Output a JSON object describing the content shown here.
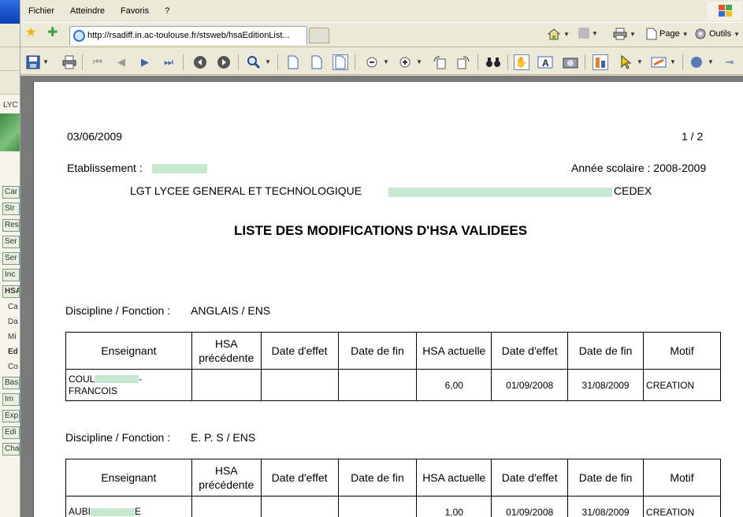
{
  "menu": [
    "Fichier",
    "Atteindre",
    "Favoris",
    "?"
  ],
  "address": {
    "url": "http://rsadiff.in.ac-toulouse.fr/stsweb/hsaEditionList..."
  },
  "ie_tools": {
    "page_label": "Page",
    "tools_label": "Outils"
  },
  "background_window": {
    "header": "LYC",
    "nav_items": [
      "Car",
      "Str",
      "Res",
      "Ser",
      "Ser",
      "Inc",
      "HSA"
    ],
    "sub_items": [
      "Ca",
      "Da",
      "Mi",
      "Ed",
      "Co"
    ],
    "nav_items_2": [
      "Bas",
      "Im",
      "Exp",
      "Edi",
      "Cha"
    ]
  },
  "document": {
    "date": "03/06/2009",
    "pagination": "1 / 2",
    "etab_label": "Etablissement :",
    "school_year": "Année scolaire : 2008-2009",
    "school_name_start": "LGT LYCEE GENERAL ET TECHNOLOGIQUE",
    "school_name_end": "CEDEX",
    "title": "LISTE DES MODIFICATIONS D'HSA VALIDEES",
    "columns": {
      "enseignant": "Enseignant",
      "hsa_prev_1": "HSA",
      "hsa_prev_2": "précédente",
      "date_effet": "Date d'effet",
      "date_fin": "Date de fin",
      "hsa_actuelle": "HSA actuelle",
      "motif": "Motif"
    },
    "sections": [
      {
        "label": "Discipline / Fonction :",
        "value": "ANGLAIS / ENS",
        "row": {
          "name_line1": "COUL",
          "name_line1_end": "-",
          "name_line2": "FRANCOIS",
          "hsa_actuelle": "6,00",
          "date_effet": "01/09/2008",
          "date_fin": "31/08/2009",
          "motif": "CREATION"
        }
      },
      {
        "label": "Discipline / Fonction :",
        "value": "E. P. S / ENS",
        "row": {
          "name_line1": "AUBI",
          "name_line1_end": "E",
          "hsa_actuelle": "1,00",
          "date_effet": "01/09/2008",
          "date_fin": "31/08/2009",
          "motif": "CREATION"
        }
      }
    ]
  },
  "colors": {
    "redaction": "#c6e8cf",
    "viewer_bg": "#7a7a7a",
    "chrome": "#ece9d8"
  }
}
